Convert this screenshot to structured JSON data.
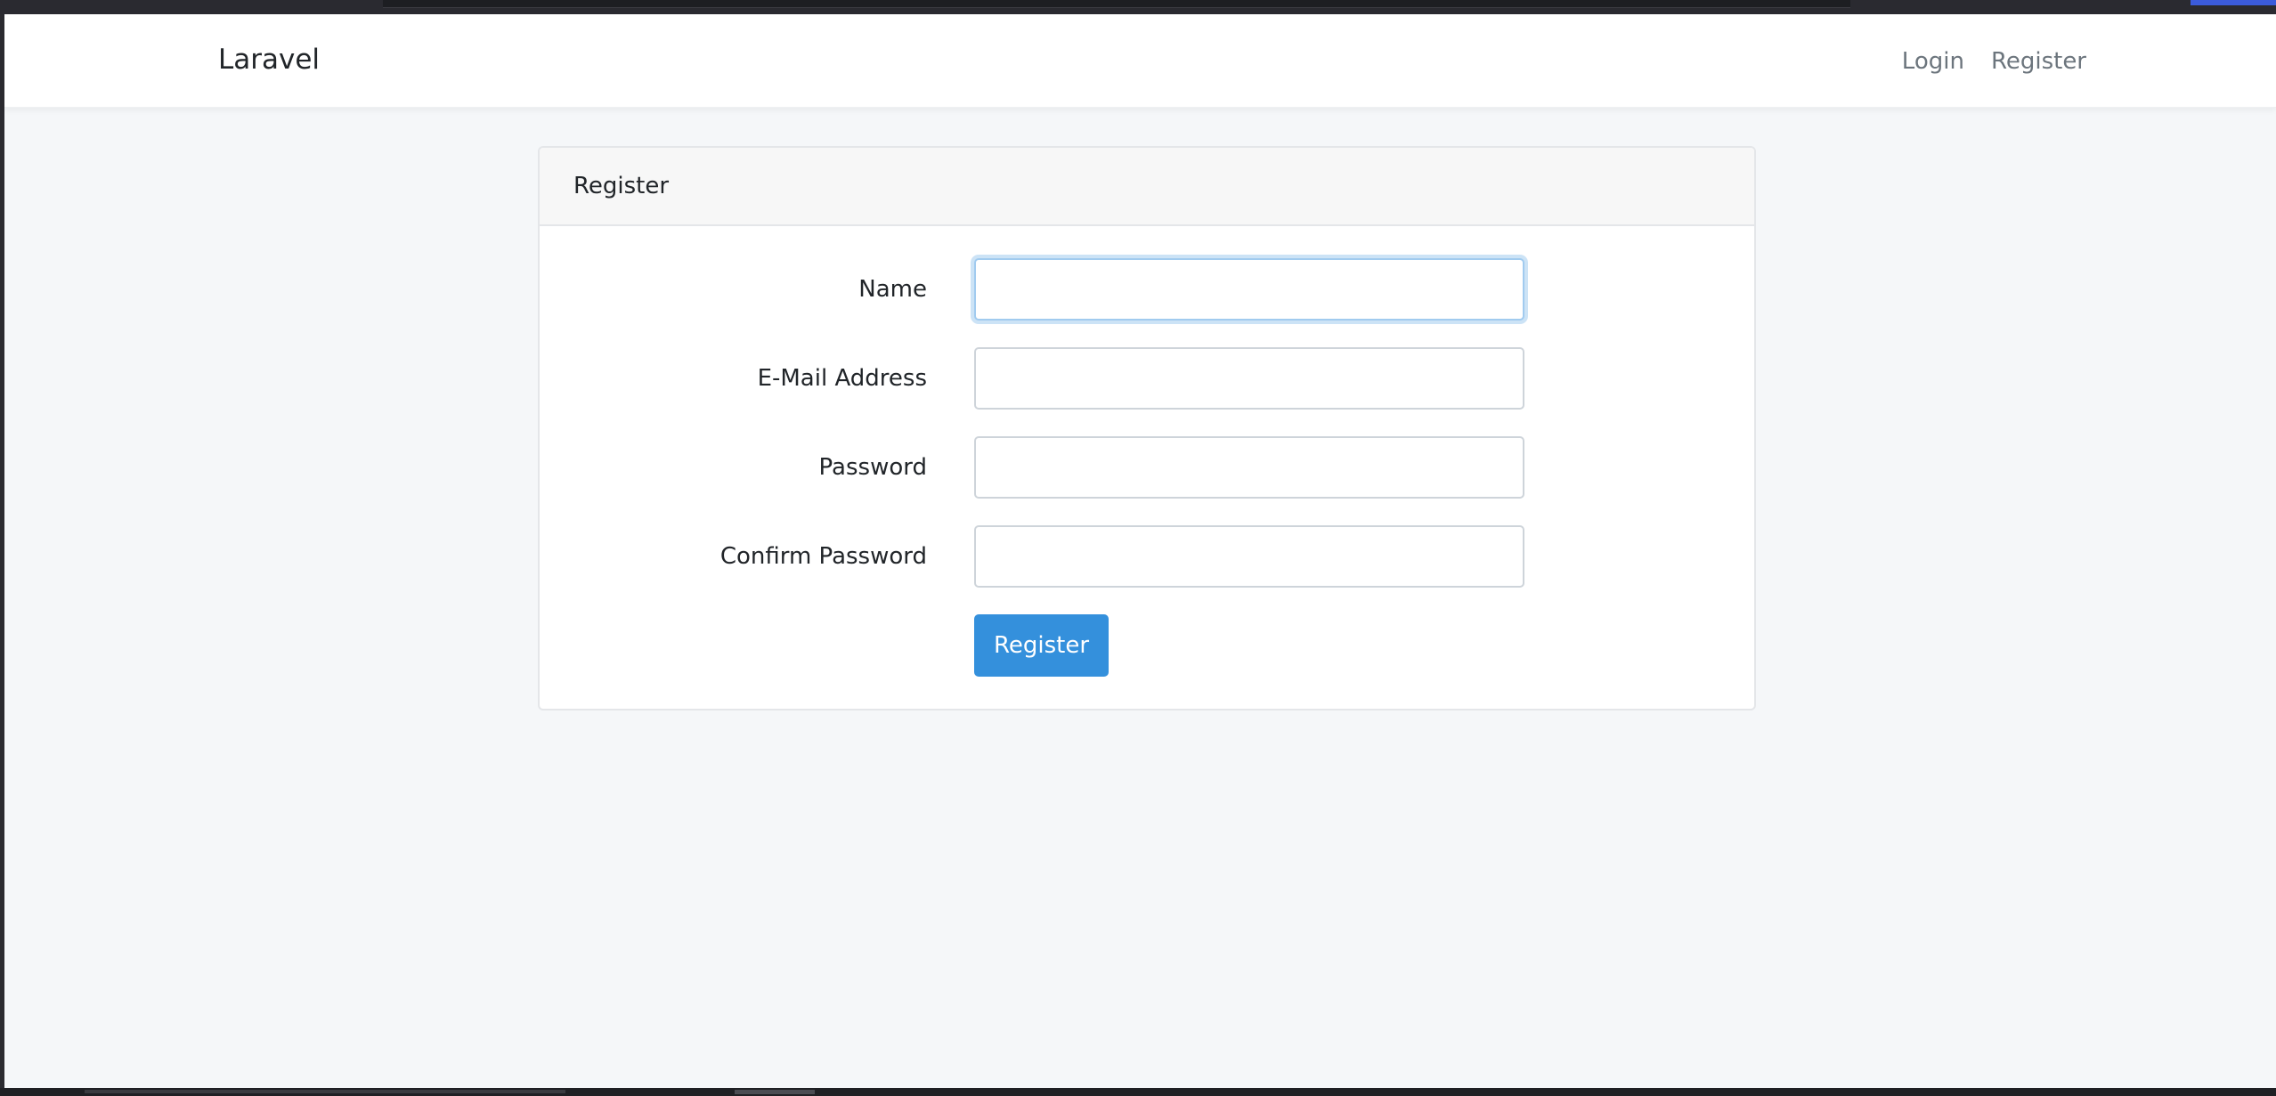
{
  "navbar": {
    "brand": "Laravel",
    "links": [
      {
        "label": "Login"
      },
      {
        "label": "Register"
      }
    ]
  },
  "card": {
    "header": "Register",
    "fields": [
      {
        "label": "Name",
        "value": "",
        "placeholder": ""
      },
      {
        "label": "E-Mail Address",
        "value": "",
        "placeholder": ""
      },
      {
        "label": "Password",
        "value": "",
        "placeholder": ""
      },
      {
        "label": "Confirm Password",
        "value": "",
        "placeholder": ""
      }
    ],
    "submit_label": "Register"
  },
  "colors": {
    "primary": "#3490dc",
    "page_background": "#f5f7f9",
    "navbar_background": "#ffffff"
  }
}
